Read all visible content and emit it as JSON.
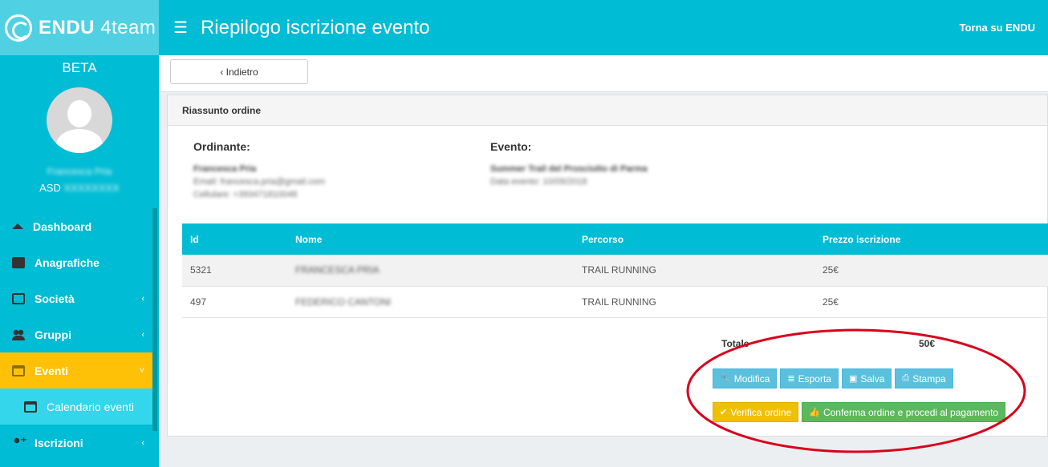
{
  "brand": {
    "name_bold": "ENDU",
    "name_light": "4team",
    "beta": "BETA"
  },
  "user": {
    "name": "Francesca Pria",
    "org_prefix": "ASD",
    "org_name": "XXXXXXXX"
  },
  "sidebar": {
    "items": [
      {
        "label": "Dashboard",
        "icon": "home-icon",
        "chevron": ""
      },
      {
        "label": "Anagrafiche",
        "icon": "book-icon",
        "chevron": ""
      },
      {
        "label": "Società",
        "icon": "id-card-icon",
        "chevron": "‹"
      },
      {
        "label": "Gruppi",
        "icon": "users-icon",
        "chevron": "‹"
      },
      {
        "label": "Eventi",
        "icon": "calendar-icon",
        "chevron": "˅"
      },
      {
        "label": "Calendario eventi",
        "icon": "calendar-check-icon",
        "chevron": ""
      },
      {
        "label": "Iscrizioni",
        "icon": "user-plus-icon",
        "chevron": "‹"
      }
    ]
  },
  "topbar": {
    "menu_icon": "☰",
    "title": "Riepilogo iscrizione evento",
    "back_link": "Torna su ENDU"
  },
  "toolbar": {
    "back_label": "Indietro"
  },
  "panel": {
    "title": "Riassunto ordine",
    "ordinante": {
      "heading": "Ordinante:",
      "name": "Francesca Pria",
      "email": "Email: francesca.pria@gmail.com",
      "phone": "Cellulare: +393471810048"
    },
    "evento": {
      "heading": "Evento:",
      "name": "Summer Trail del Prosciutto di Parma",
      "date": "Data evento: 10/09/2018"
    },
    "table": {
      "headers": [
        "Id",
        "Nome",
        "Percorso",
        "Prezzo iscrizione"
      ],
      "rows": [
        {
          "id": "5321",
          "nome": "FRANCESCA PRIA",
          "percorso": "TRAIL RUNNING",
          "prezzo": "25€"
        },
        {
          "id": "497",
          "nome": "FEDERICO CANTONI",
          "percorso": "TRAIL RUNNING",
          "prezzo": "25€"
        }
      ]
    },
    "totale_label": "Totale",
    "totale_value": "50€",
    "buttons": {
      "modifica": "Modifica",
      "esporta": "Esporta",
      "salva": "Salva",
      "stampa": "Stampa",
      "verifica": "Verifica ordine",
      "conferma": "Conferma ordine e procedi al pagamento"
    }
  },
  "colors": {
    "primary": "#00bcd4",
    "active": "#ffc107",
    "info": "#5bc0de",
    "warning": "#f0c000",
    "success": "#5cb85c",
    "annotation": "#d9001b"
  }
}
